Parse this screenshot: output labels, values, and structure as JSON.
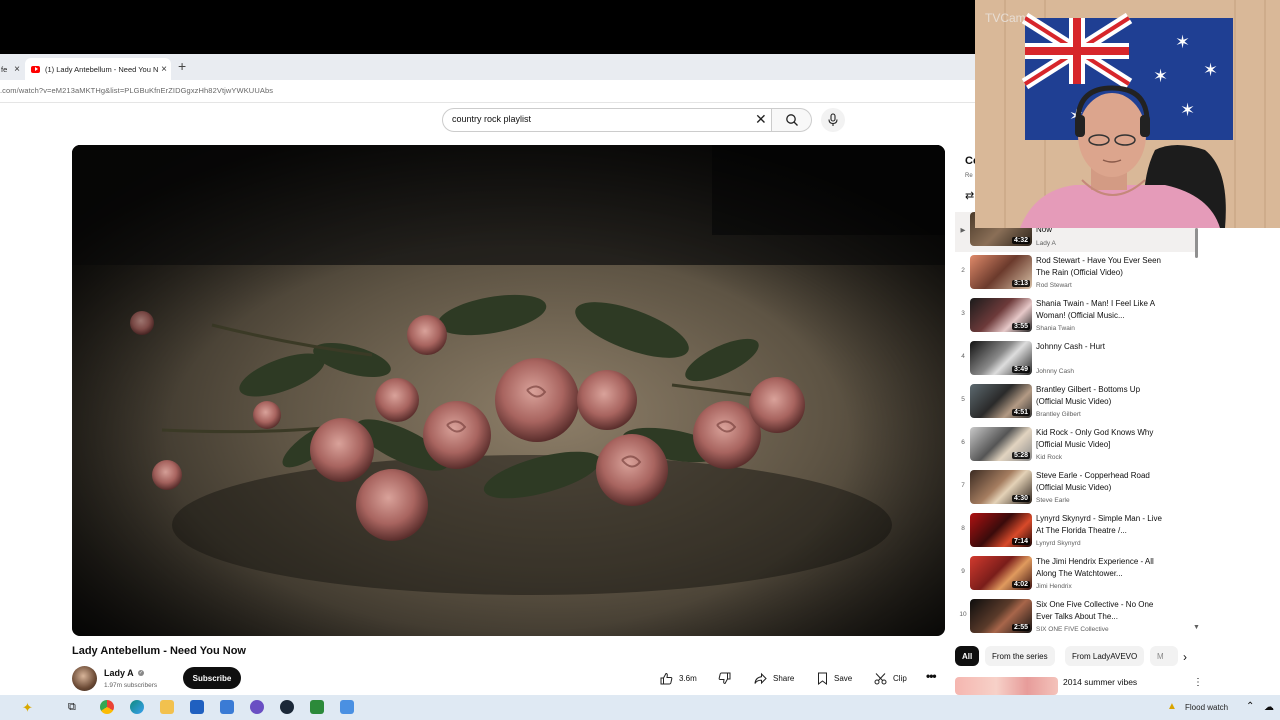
{
  "browser": {
    "prev_tab_label": "fe",
    "active_tab_label": "(1) Lady Antebellum - Need You N",
    "new_tab_symbol": "+",
    "url": ".com/watch?v=eM213aMKTHg&list=PLGBuKfnErZIDGgxzHh82VtjwYWKUUAbs"
  },
  "search": {
    "query": "country rock playlist"
  },
  "video": {
    "title": "Lady Antebellum - Need You Now",
    "channel": "Lady A",
    "subscribers": "1.97m subscribers",
    "subscribe_label": "Subscribe",
    "likes": "3.6m",
    "share_label": "Share",
    "save_label": "Save",
    "clip_label": "Clip",
    "more_label": "•••"
  },
  "playlist": {
    "header_partial": "Co",
    "subheader_partial": "Re",
    "current": {
      "title": "Now",
      "artist": "Lady A",
      "duration": "4:32",
      "play_marker": "▶"
    },
    "items": [
      {
        "num": "2",
        "title": "Rod Stewart - Have You Ever Seen The Rain (Official Video)",
        "artist": "Rod Stewart",
        "duration": "3:13"
      },
      {
        "num": "3",
        "title": "Shania Twain - Man! I Feel Like A Woman! (Official Music...",
        "artist": "Shania Twain",
        "duration": "3:55"
      },
      {
        "num": "4",
        "title": "Johnny Cash - Hurt",
        "artist": "Johnny Cash",
        "duration": "3:49"
      },
      {
        "num": "5",
        "title": "Brantley Gilbert - Bottoms Up (Official Music Video)",
        "artist": "Brantley Gilbert",
        "duration": "4:51"
      },
      {
        "num": "6",
        "title": "Kid Rock - Only God Knows Why [Official Music Video]",
        "artist": "Kid Rock",
        "duration": "5:28"
      },
      {
        "num": "7",
        "title": "Steve Earle - Copperhead Road (Official Music Video)",
        "artist": "Steve Earle",
        "duration": "4:30"
      },
      {
        "num": "8",
        "title": "Lynyrd Skynyrd - Simple Man - Live At The Florida Theatre /...",
        "artist": "Lynyrd Skynyrd",
        "duration": "7:14"
      },
      {
        "num": "9",
        "title": "The Jimi Hendrix Experience - All Along The Watchtower...",
        "artist": "Jimi Hendrix",
        "duration": "4:02"
      },
      {
        "num": "10",
        "title": "Six One Five Collective - No One Ever Talks About The...",
        "artist": "SIX ONE FIVE Collective",
        "duration": "2:55"
      }
    ]
  },
  "chips": [
    "All",
    "From the series",
    "From LadyAVEVO",
    "M"
  ],
  "recommendation": {
    "title": "2014 summer vibes"
  },
  "webcam": {
    "overlay_text": "TVCam"
  },
  "taskbar": {
    "weather_text": "Flood watch"
  }
}
